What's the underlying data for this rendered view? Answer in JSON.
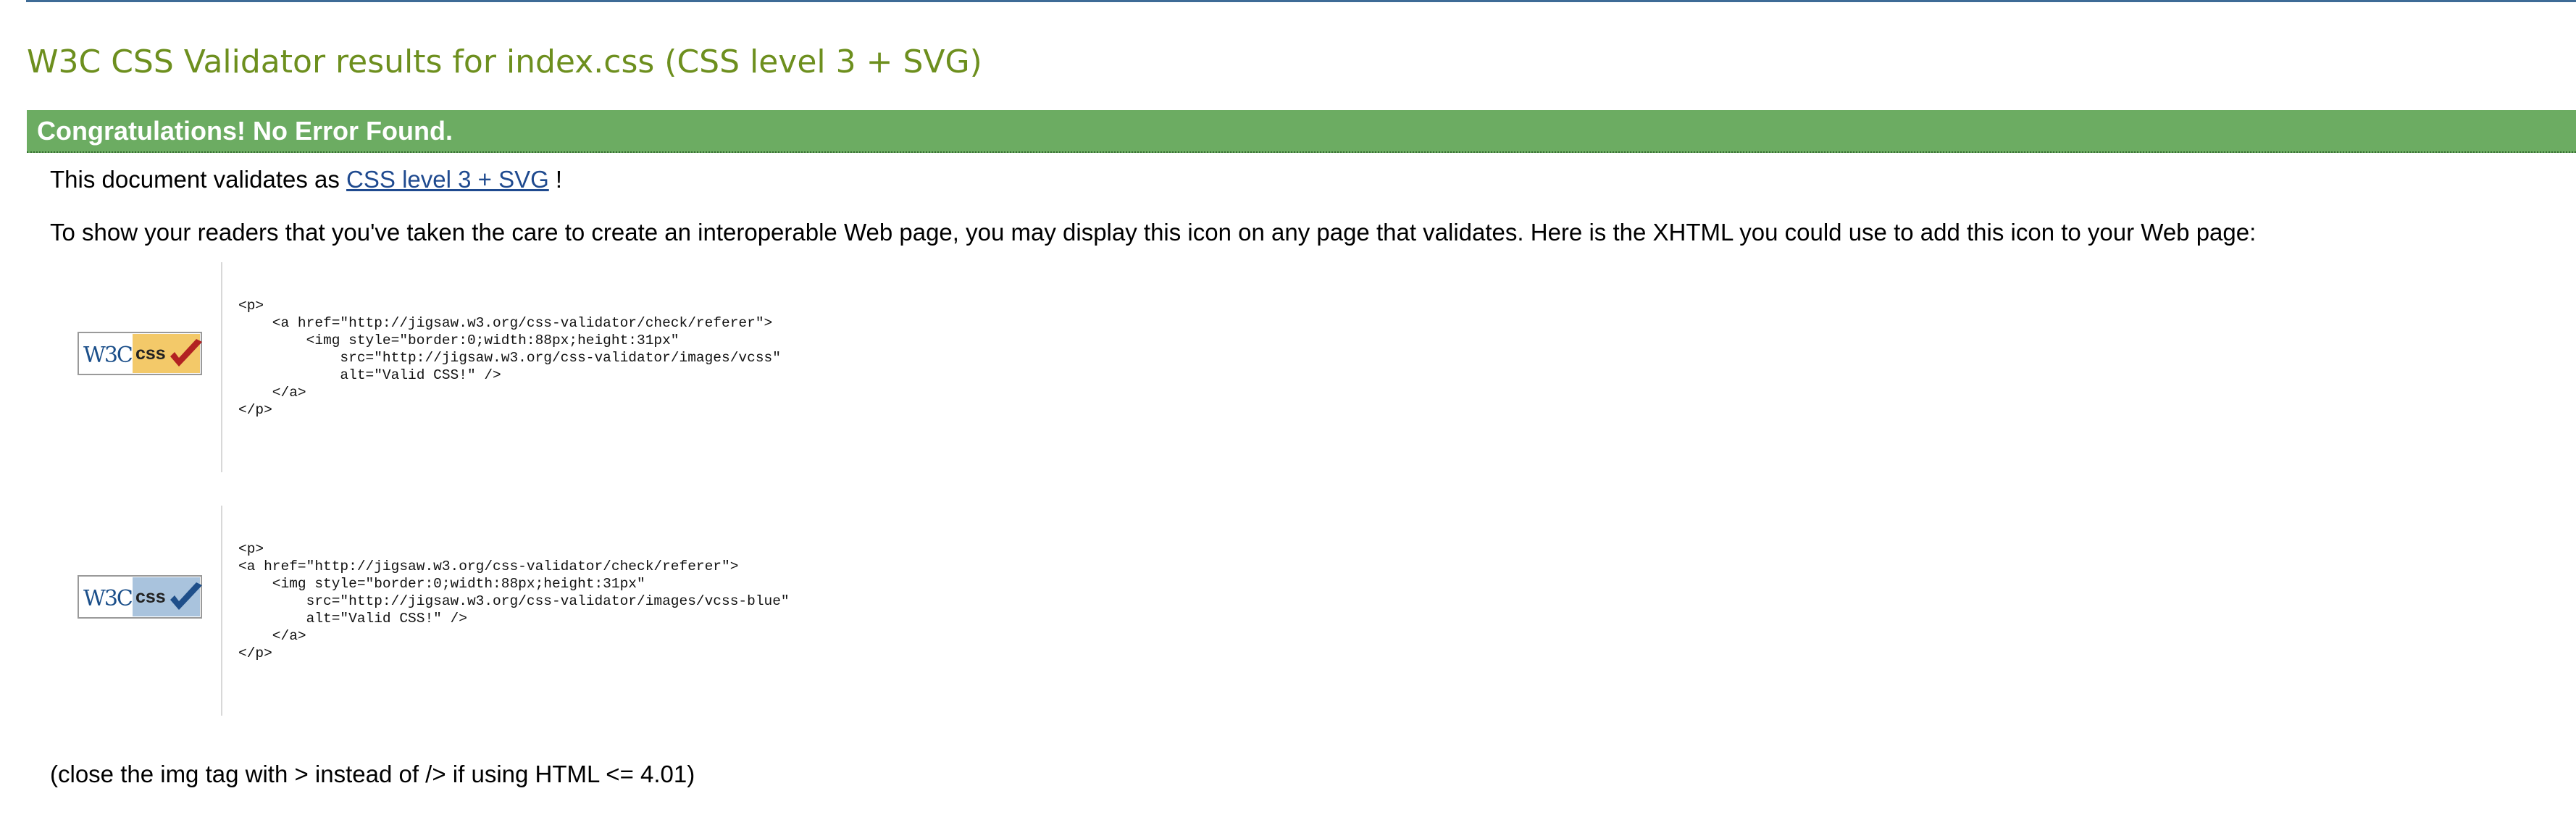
{
  "page": {
    "title": "W3C CSS Validator results for index.css (CSS level 3 + SVG)",
    "congrats": "Congratulations! No Error Found."
  },
  "validates": {
    "prefix": "This document validates as ",
    "link_text": "CSS level 3 + SVG",
    "suffix": " !"
  },
  "info_text": "To show your readers that you've taken the care to create an interoperable Web page, you may display this icon on any page that validates. Here is the XHTML you could use to add this icon to your Web page:",
  "badges": [
    {
      "icon": "w3c-css-valid-badge-gold",
      "accent": "#f3c969",
      "check_color": "#b22222",
      "badge_text_w3c": "W3C",
      "badge_text_css": "css",
      "code": "<p>\n    <a href=\"http://jigsaw.w3.org/css-validator/check/referer\">\n        <img style=\"border:0;width:88px;height:31px\"\n            src=\"http://jigsaw.w3.org/css-validator/images/vcss\"\n            alt=\"Valid CSS!\" />\n    </a>\n</p>"
    },
    {
      "icon": "w3c-css-valid-badge-blue",
      "accent": "#a9c3dd",
      "check_color": "#1f4f8a",
      "badge_text_w3c": "W3C",
      "badge_text_css": "css",
      "code": "<p>\n<a href=\"http://jigsaw.w3.org/css-validator/check/referer\">\n    <img style=\"border:0;width:88px;height:31px\"\n        src=\"http://jigsaw.w3.org/css-validator/images/vcss-blue\"\n        alt=\"Valid CSS!\" />\n    </a>\n</p>"
    }
  ],
  "footer_note": "(close the img tag with > instead of /> if using HTML <= 4.01)",
  "colors": {
    "title": "#6d8f1e",
    "congrats_bg": "#6cac62",
    "link": "#1f4a8f",
    "top_rule": "#3e6b96"
  }
}
